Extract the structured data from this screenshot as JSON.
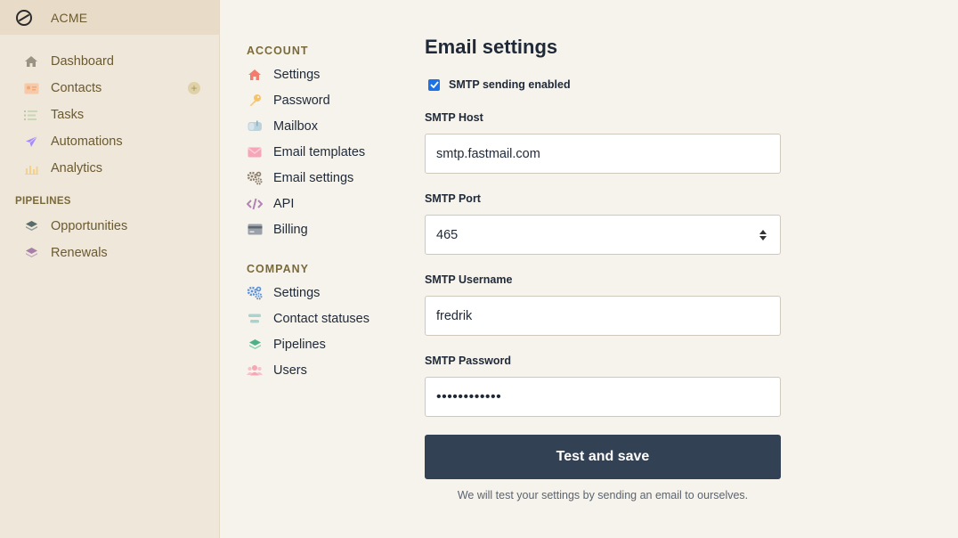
{
  "brand": {
    "name": "ACME"
  },
  "sidebar": {
    "items": [
      {
        "label": "Dashboard",
        "icon": "home-icon"
      },
      {
        "label": "Contacts",
        "icon": "contact-card-icon",
        "add_label": "+"
      },
      {
        "label": "Tasks",
        "icon": "tasks-list-icon"
      },
      {
        "label": "Automations",
        "icon": "paper-plane-icon"
      },
      {
        "label": "Analytics",
        "icon": "bar-chart-icon"
      }
    ],
    "pipelines_title": "PIPELINES",
    "pipelines": [
      {
        "label": "Opportunities",
        "icon": "layers-icon"
      },
      {
        "label": "Renewals",
        "icon": "layers-icon"
      }
    ]
  },
  "settings_nav": {
    "account_title": "ACCOUNT",
    "account": [
      {
        "label": "Settings",
        "icon": "home-icon"
      },
      {
        "label": "Password",
        "icon": "key-icon"
      },
      {
        "label": "Mailbox",
        "icon": "mailbox-icon"
      },
      {
        "label": "Email templates",
        "icon": "envelope-icon"
      },
      {
        "label": "Email settings",
        "icon": "gears-icon"
      },
      {
        "label": "API",
        "icon": "code-icon"
      },
      {
        "label": "Billing",
        "icon": "credit-card-icon"
      }
    ],
    "company_title": "COMPANY",
    "company": [
      {
        "label": "Settings",
        "icon": "gears-icon"
      },
      {
        "label": "Contact statuses",
        "icon": "status-bars-icon"
      },
      {
        "label": "Pipelines",
        "icon": "layers-icon"
      },
      {
        "label": "Users",
        "icon": "users-icon"
      }
    ]
  },
  "form": {
    "title": "Email settings",
    "smtp_enabled_label": "SMTP sending enabled",
    "smtp_enabled": true,
    "host_label": "SMTP Host",
    "host_value": "smtp.fastmail.com",
    "port_label": "SMTP Port",
    "port_value": "465",
    "username_label": "SMTP Username",
    "username_value": "fredrik",
    "password_label": "SMTP Password",
    "password_value": "••••••••••••",
    "submit_label": "Test and save",
    "hint": "We will test your settings by sending an email to ourselves."
  },
  "colors": {
    "sidebar_bg": "#efe7da",
    "content_bg": "#f6f3ec",
    "button_bg": "#334155",
    "checkbox": "#1a73e8"
  }
}
